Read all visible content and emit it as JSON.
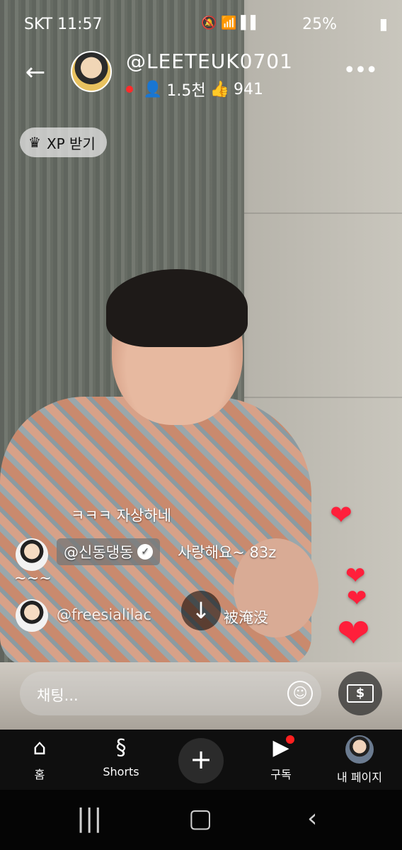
{
  "status_bar": {
    "carrier_time": "SKT 11:57",
    "battery": "25%"
  },
  "header": {
    "handle": "@LEETEUK0701",
    "viewers": "1.5천",
    "likes": "941"
  },
  "xp_button": {
    "label": "XP 받기"
  },
  "chat": {
    "line1": "ㅋㅋㅋ 자상하네",
    "msg2_user": "@신동댕동",
    "msg2_text": "사랑해요~ 83z",
    "msg2_cont": "~~~",
    "msg3_user": "@freesialilac",
    "msg3_text": "被淹没"
  },
  "composer": {
    "placeholder": "채팅..."
  },
  "bottom_nav": {
    "home": "홈",
    "shorts": "Shorts",
    "subs": "구독",
    "me": "내 페이지"
  },
  "colors": {
    "accent": "#ff1f3b",
    "nav_bg": "#0f0f0f"
  }
}
